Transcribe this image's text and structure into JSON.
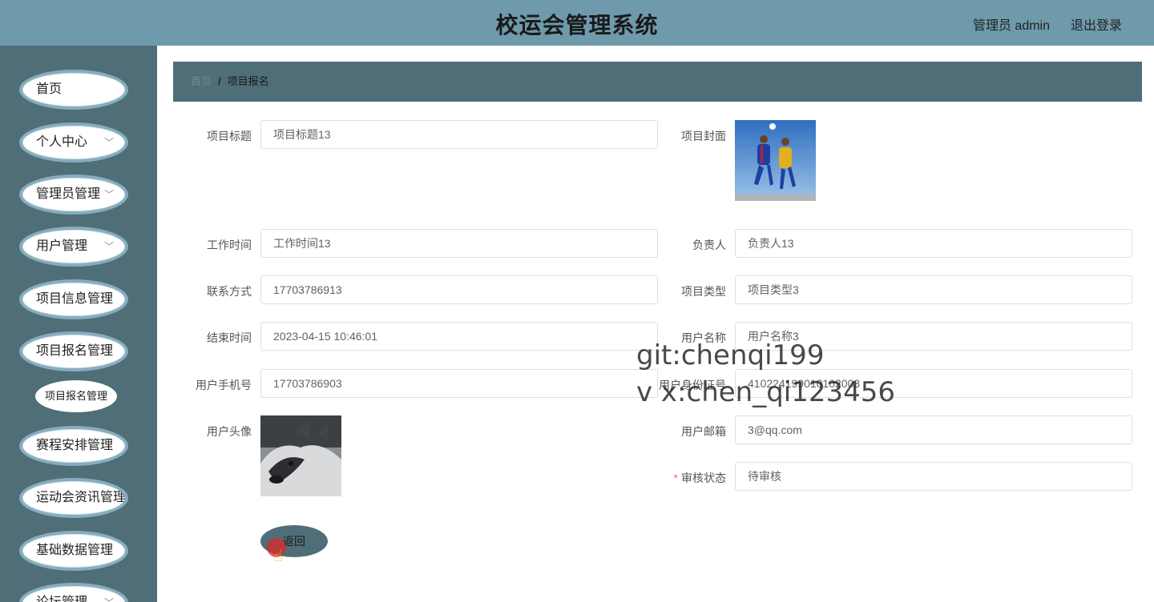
{
  "header": {
    "title": "校运会管理系统",
    "user": "管理员 admin",
    "logout": "退出登录"
  },
  "sidebar": {
    "items": [
      {
        "label": "首页",
        "has_chevron": false
      },
      {
        "label": "个人中心",
        "has_chevron": true
      },
      {
        "label": "管理员管理",
        "has_chevron": true
      },
      {
        "label": "用户管理",
        "has_chevron": true
      },
      {
        "label": "项目信息管理",
        "has_chevron": true
      },
      {
        "label": "项目报名管理",
        "has_chevron": true
      },
      {
        "label": "赛程安排管理",
        "has_chevron": true
      },
      {
        "label": "运动会资讯管理",
        "has_chevron": true
      },
      {
        "label": "基础数据管理",
        "has_chevron": true
      },
      {
        "label": "论坛管理",
        "has_chevron": true
      }
    ],
    "sub_items": [
      {
        "label": "项目报名管理"
      }
    ]
  },
  "breadcrumb": {
    "home": "首页",
    "separator": "/",
    "current": "项目报名"
  },
  "form": {
    "project_title": {
      "label": "项目标题",
      "value": "项目标题13"
    },
    "project_cover": {
      "label": "项目封面",
      "image": "soccer-players-photo"
    },
    "work_time": {
      "label": "工作时间",
      "value": "工作时间13"
    },
    "person_in_charge": {
      "label": "负责人",
      "value": "负责人13"
    },
    "contact": {
      "label": "联系方式",
      "value": "17703786913"
    },
    "project_type": {
      "label": "项目类型",
      "value": "项目类型3"
    },
    "end_time": {
      "label": "结束时间",
      "value": "2023-04-15 10:46:01"
    },
    "user_name": {
      "label": "用户名称",
      "value": "用户名称3"
    },
    "user_phone": {
      "label": "用户手机号",
      "value": "17703786903"
    },
    "user_id_card": {
      "label": "用户身份证号",
      "value": "410224199010102003"
    },
    "user_avatar": {
      "label": "用户头像",
      "image": "husky-dog-photo"
    },
    "user_email": {
      "label": "用户邮箱",
      "value": "3@qq.com"
    },
    "review_status": {
      "label": "审核状态",
      "value": "待审核",
      "required_mark": "*"
    }
  },
  "buttons": {
    "back": "返回"
  },
  "watermark": {
    "line1": "git:chenqi199",
    "line2": "v x:chen_qi123456"
  },
  "colors": {
    "header_bg": "#6e9aac",
    "sidebar_bg": "#4f6e78",
    "breadcrumb_bg": "#4f6e78",
    "menu_border": "#86adc0",
    "required": "#f56c6c"
  }
}
